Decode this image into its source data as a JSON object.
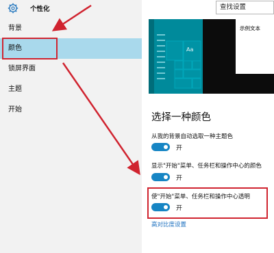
{
  "window": {
    "title": "个性化",
    "icon": "gear-icon"
  },
  "search": {
    "value": "查找设置"
  },
  "sidebar": {
    "items": [
      {
        "label": "背景"
      },
      {
        "label": "颜色",
        "selected": true
      },
      {
        "label": "锁屏界面"
      },
      {
        "label": "主题"
      },
      {
        "label": "开始"
      }
    ]
  },
  "preview": {
    "sample_text": "示例文本",
    "tile_label": "Aa"
  },
  "colors_section": {
    "title": "选择一种颜色",
    "settings": [
      {
        "label": "从我的背景自动选取一种主题色",
        "state": "开",
        "on": true
      },
      {
        "label": "显示\"开始\"菜单、任务栏和操作中心的颜色",
        "state": "开",
        "on": true
      },
      {
        "label": "使\"开始\"菜单、任务栏和操作中心透明",
        "state": "开",
        "on": true
      }
    ],
    "link": "高对比度设置"
  },
  "colors": {
    "accent": "#1685c4",
    "selected_nav": "#a9d9ec",
    "annotation": "#d0232f",
    "start_tile": "#008a9b"
  }
}
